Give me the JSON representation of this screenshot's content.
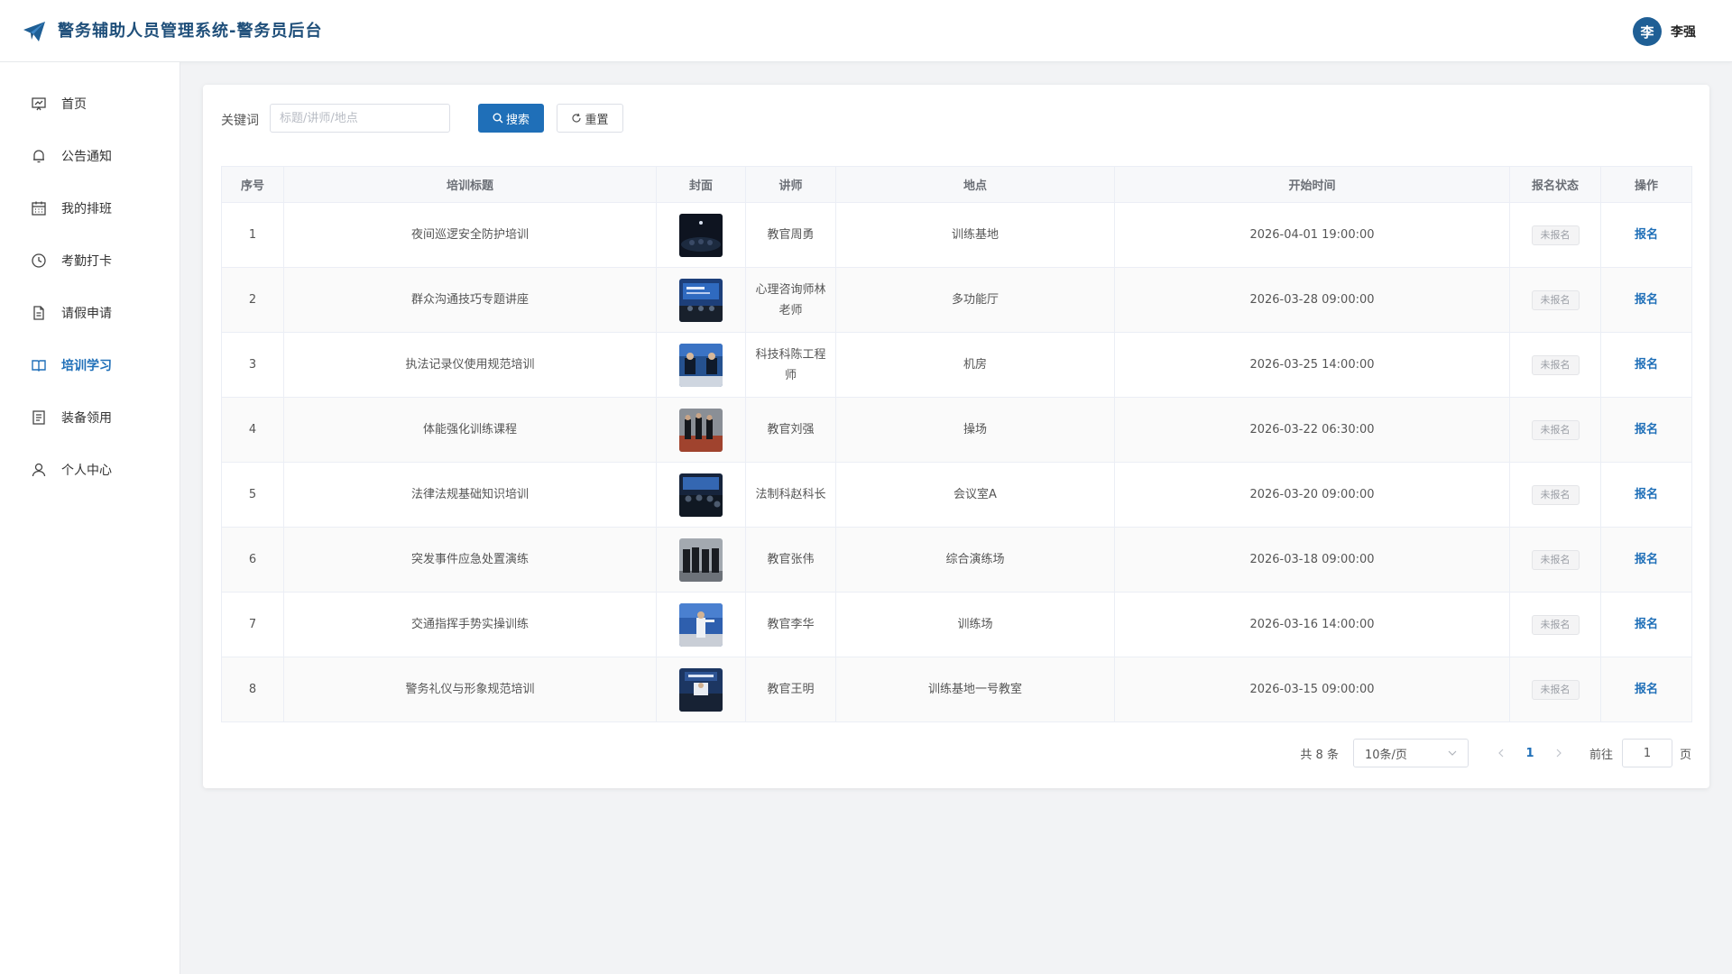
{
  "header": {
    "title": "警务辅助人员管理系统-警务员后台",
    "user": {
      "avatar_char": "李",
      "name": "李强"
    },
    "colors": {
      "brand": "#1f4f7a",
      "accent": "#1f6fb8"
    }
  },
  "sidebar": {
    "items": [
      {
        "label": "首页",
        "icon": "dashboard-icon",
        "active": false
      },
      {
        "label": "公告通知",
        "icon": "bell-icon",
        "active": false
      },
      {
        "label": "我的排班",
        "icon": "calendar-icon",
        "active": false
      },
      {
        "label": "考勤打卡",
        "icon": "clock-icon",
        "active": false
      },
      {
        "label": "请假申请",
        "icon": "document-icon",
        "active": false
      },
      {
        "label": "培训学习",
        "icon": "book-icon",
        "active": true
      },
      {
        "label": "装备领用",
        "icon": "list-icon",
        "active": false
      },
      {
        "label": "个人中心",
        "icon": "user-icon",
        "active": false
      }
    ]
  },
  "filter": {
    "keyword_label": "关键词",
    "keyword_placeholder": "标题/讲师/地点",
    "keyword_value": "",
    "search_label": "搜索",
    "reset_label": "重置"
  },
  "table": {
    "columns": [
      "序号",
      "培训标题",
      "封面",
      "讲师",
      "地点",
      "开始时间",
      "报名状态",
      "操作"
    ],
    "rows": [
      {
        "no": "1",
        "title": "夜间巡逻安全防护培训",
        "lecturer": "教官周勇",
        "location": "训练基地",
        "start": "2026-04-01 19:00:00",
        "status": "未报名",
        "action": "报名"
      },
      {
        "no": "2",
        "title": "群众沟通技巧专题讲座",
        "lecturer": "心理咨询师林老师",
        "location": "多功能厅",
        "start": "2026-03-28 09:00:00",
        "status": "未报名",
        "action": "报名"
      },
      {
        "no": "3",
        "title": "执法记录仪使用规范培训",
        "lecturer": "科技科陈工程师",
        "location": "机房",
        "start": "2026-03-25 14:00:00",
        "status": "未报名",
        "action": "报名"
      },
      {
        "no": "4",
        "title": "体能强化训练课程",
        "lecturer": "教官刘强",
        "location": "操场",
        "start": "2026-03-22 06:30:00",
        "status": "未报名",
        "action": "报名"
      },
      {
        "no": "5",
        "title": "法律法规基础知识培训",
        "lecturer": "法制科赵科长",
        "location": "会议室A",
        "start": "2026-03-20 09:00:00",
        "status": "未报名",
        "action": "报名"
      },
      {
        "no": "6",
        "title": "突发事件应急处置演练",
        "lecturer": "教官张伟",
        "location": "综合演练场",
        "start": "2026-03-18 09:00:00",
        "status": "未报名",
        "action": "报名"
      },
      {
        "no": "7",
        "title": "交通指挥手势实操训练",
        "lecturer": "教官李华",
        "location": "训练场",
        "start": "2026-03-16 14:00:00",
        "status": "未报名",
        "action": "报名"
      },
      {
        "no": "8",
        "title": "警务礼仪与形象规范培训",
        "lecturer": "教官王明",
        "location": "训练基地一号教室",
        "start": "2026-03-15 09:00:00",
        "status": "未报名",
        "action": "报名"
      }
    ]
  },
  "pagination": {
    "total_text": "共 8 条",
    "page_size": "10条/页",
    "current_page": "1",
    "goto_label": "前往",
    "goto_value": "1",
    "goto_suffix": "页"
  }
}
